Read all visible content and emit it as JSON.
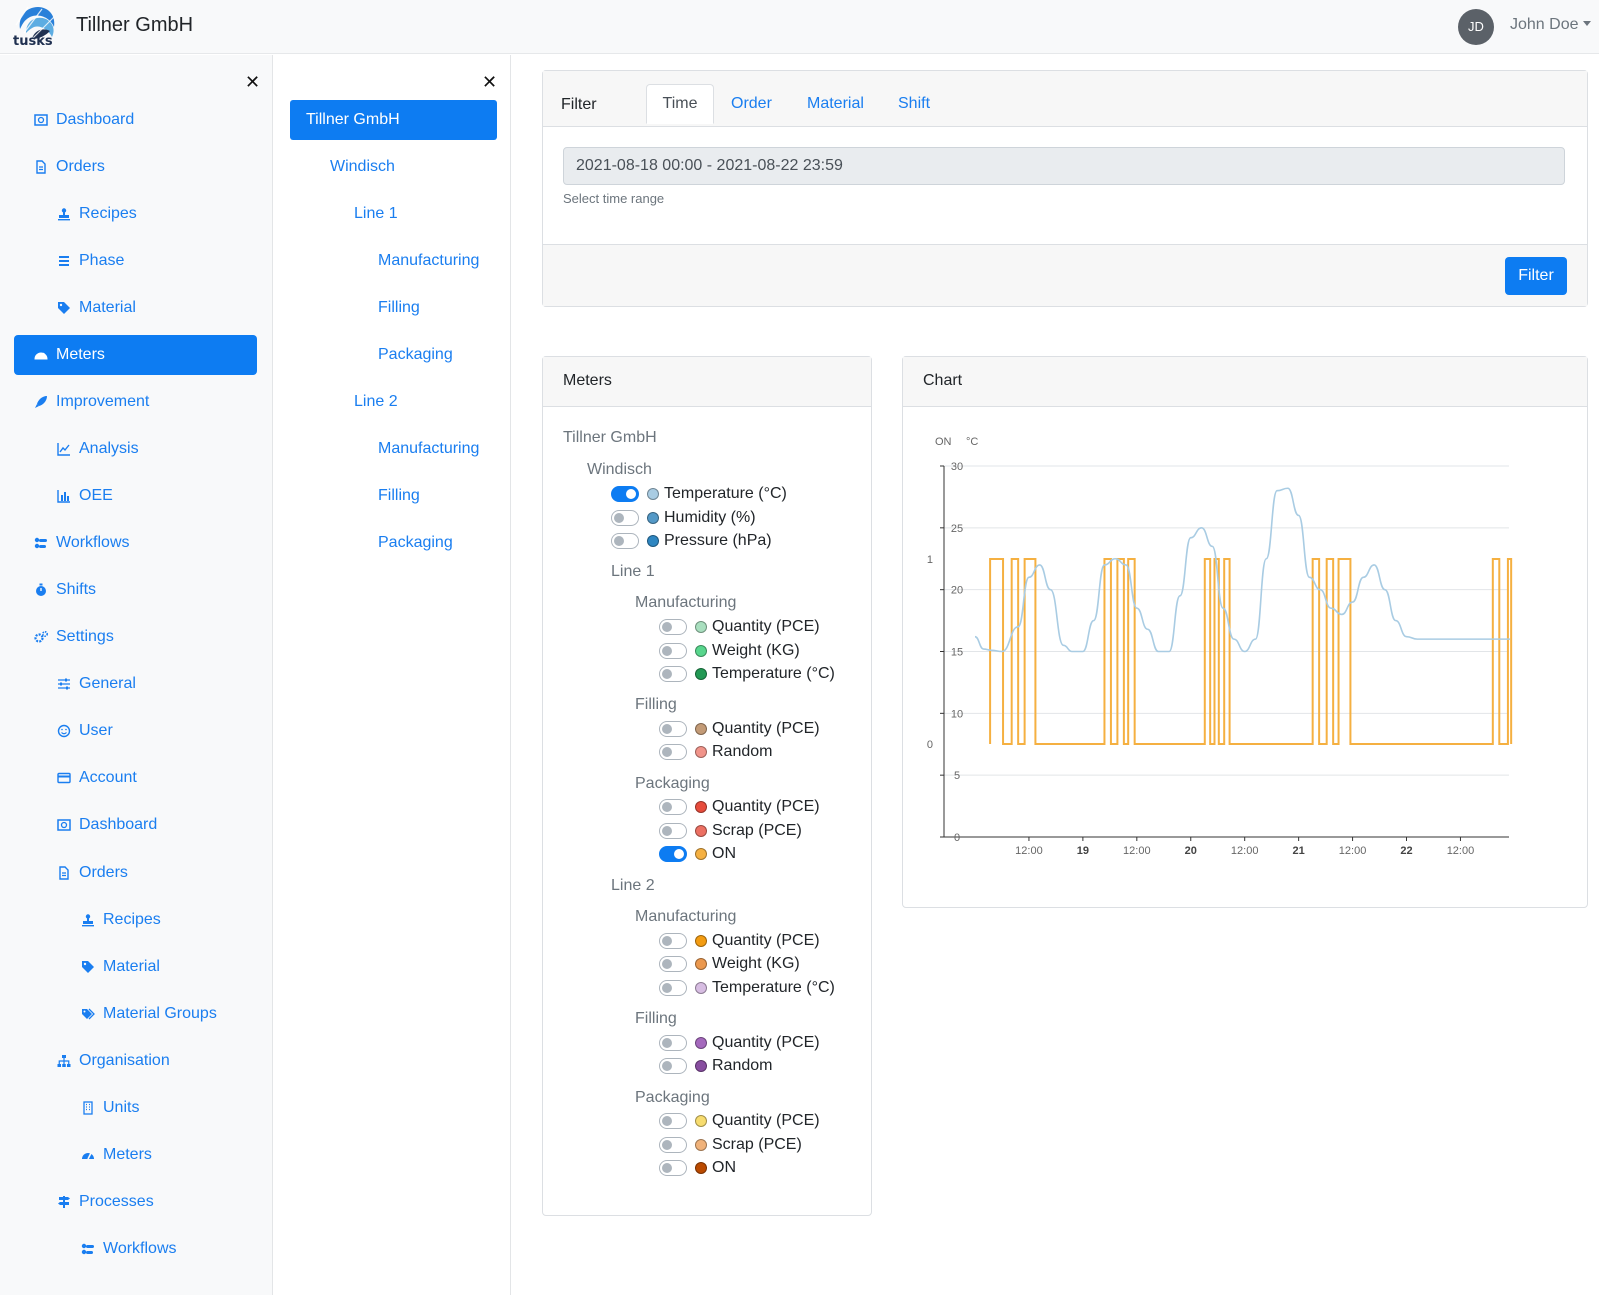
{
  "header": {
    "brand": "Tillner GmbH",
    "logo_text": "tusks",
    "avatar_initials": "JD",
    "user_name": "John Doe"
  },
  "sidebar": {
    "items": [
      {
        "label": "Dashboard",
        "icon": "dashboard-icon"
      },
      {
        "label": "Orders",
        "icon": "file-icon"
      },
      {
        "label": "Recipes",
        "icon": "stamp-icon"
      },
      {
        "label": "Phase",
        "icon": "stack-icon"
      },
      {
        "label": "Material",
        "icon": "tag-icon"
      },
      {
        "label": "Meters",
        "icon": "gauge-icon"
      },
      {
        "label": "Improvement",
        "icon": "rocket-icon"
      },
      {
        "label": "Analysis",
        "icon": "line-chart-icon"
      },
      {
        "label": "OEE",
        "icon": "bar-chart-icon"
      },
      {
        "label": "Workflows",
        "icon": "workflow-icon"
      },
      {
        "label": "Shifts",
        "icon": "stopwatch-icon"
      },
      {
        "label": "Settings",
        "icon": "gears-icon"
      },
      {
        "label": "General",
        "icon": "sliders-icon"
      },
      {
        "label": "User",
        "icon": "smile-icon"
      },
      {
        "label": "Account",
        "icon": "card-icon"
      },
      {
        "label": "Dashboard",
        "icon": "dashboard-icon"
      },
      {
        "label": "Orders",
        "icon": "file-icon"
      },
      {
        "label": "Recipes",
        "icon": "stamp-icon"
      },
      {
        "label": "Material",
        "icon": "tag-icon"
      },
      {
        "label": "Material Groups",
        "icon": "tags-icon"
      },
      {
        "label": "Organisation",
        "icon": "sitemap-icon"
      },
      {
        "label": "Units",
        "icon": "building-icon"
      },
      {
        "label": "Meters",
        "icon": "gauge-icon"
      },
      {
        "label": "Processes",
        "icon": "signpost-icon"
      },
      {
        "label": "Workflows",
        "icon": "workflow-icon"
      }
    ]
  },
  "tree": {
    "items": [
      {
        "label": "Tillner GmbH"
      },
      {
        "label": "Windisch"
      },
      {
        "label": "Line 1"
      },
      {
        "label": "Manufacturing"
      },
      {
        "label": "Filling"
      },
      {
        "label": "Packaging"
      },
      {
        "label": "Line 2"
      },
      {
        "label": "Manufacturing"
      },
      {
        "label": "Filling"
      },
      {
        "label": "Packaging"
      }
    ]
  },
  "filter": {
    "title": "Filter",
    "tabs": [
      "Time",
      "Order",
      "Material",
      "Shift"
    ],
    "range_value": "2021-08-18 00:00 - 2021-08-22 23:59",
    "help": "Select time range",
    "button": "Filter"
  },
  "meters": {
    "title": "Meters",
    "company": "Tillner GmbH",
    "site": "Windisch",
    "site_meters": [
      {
        "label": "Temperature (°C)",
        "color": "#a9cce3",
        "on": true
      },
      {
        "label": "Humidity (%)",
        "color": "#5499c7",
        "on": false
      },
      {
        "label": "Pressure (hPa)",
        "color": "#2e86c1",
        "on": false
      }
    ],
    "lines": [
      {
        "name": "Line 1",
        "groups": [
          {
            "name": "Manufacturing",
            "meters": [
              {
                "label": "Quantity (PCE)",
                "color": "#a9dfbf",
                "on": false
              },
              {
                "label": "Weight (KG)",
                "color": "#58d68d",
                "on": false
              },
              {
                "label": "Temperature (°C)",
                "color": "#229954",
                "on": false
              }
            ]
          },
          {
            "name": "Filling",
            "meters": [
              {
                "label": "Quantity (PCE)",
                "color": "#c39b77",
                "on": false
              },
              {
                "label": "Random",
                "color": "#f1948a",
                "on": false
              }
            ]
          },
          {
            "name": "Packaging",
            "meters": [
              {
                "label": "Quantity (PCE)",
                "color": "#e74c3c",
                "on": false
              },
              {
                "label": "Scrap (PCE)",
                "color": "#ec7063",
                "on": false
              },
              {
                "label": "ON",
                "color": "#f5b041",
                "on": true
              }
            ]
          }
        ]
      },
      {
        "name": "Line 2",
        "groups": [
          {
            "name": "Manufacturing",
            "meters": [
              {
                "label": "Quantity (PCE)",
                "color": "#f39c12",
                "on": false
              },
              {
                "label": "Weight (KG)",
                "color": "#eb984e",
                "on": false
              },
              {
                "label": "Temperature (°C)",
                "color": "#d7bde2",
                "on": false
              }
            ]
          },
          {
            "name": "Filling",
            "meters": [
              {
                "label": "Quantity (PCE)",
                "color": "#a569bd",
                "on": false
              },
              {
                "label": "Random",
                "color": "#884ea0",
                "on": false
              }
            ]
          },
          {
            "name": "Packaging",
            "meters": [
              {
                "label": "Quantity (PCE)",
                "color": "#f7dc6f",
                "on": false
              },
              {
                "label": "Scrap (PCE)",
                "color": "#f0b27a",
                "on": false
              },
              {
                "label": "ON",
                "color": "#ba4a00",
                "on": false
              }
            ]
          }
        ]
      }
    ]
  },
  "chart_card": {
    "title": "Chart"
  },
  "chart_data": {
    "type": "line",
    "left_axis_title": "ON",
    "right_axis_title": "°C",
    "y_on_ticks": [
      "0",
      "1"
    ],
    "y_temp_ticks": [
      "0",
      "5",
      "10",
      "15",
      "20",
      "25",
      "30"
    ],
    "y_temp_range": [
      0,
      30
    ],
    "x_range": [
      "2021-08-18 00:00",
      "2021-08-22 23:59"
    ],
    "x_ticks": [
      "12:00",
      "19",
      "12:00",
      "20",
      "12:00",
      "21",
      "12:00",
      "22",
      "12:00"
    ],
    "grid": true,
    "series": [
      {
        "name": "Temperature (°C)",
        "color": "#a9cce3",
        "axis": "right",
        "x": [
          0,
          0.08,
          0.15,
          0.25,
          0.4,
          0.5,
          0.6,
          0.7,
          0.82,
          0.9,
          1.0,
          1.1,
          1.2,
          1.3,
          1.4,
          1.5,
          1.6,
          1.7,
          1.8,
          1.9,
          2.0,
          2.1,
          2.2,
          2.3,
          2.4,
          2.5,
          2.6,
          2.7,
          2.8,
          2.9,
          3.0,
          3.1,
          3.2,
          3.3,
          3.4,
          3.5,
          3.6,
          3.7,
          3.8,
          3.9,
          4.0,
          4.1,
          4.2,
          4.3,
          4.4,
          4.5,
          4.6,
          4.7,
          4.8,
          4.9,
          4.96
        ],
        "y": [
          16.2,
          15.2,
          15.1,
          15.0,
          17.0,
          21.0,
          22.0,
          20.0,
          15.5,
          15.0,
          15.0,
          17.5,
          22.0,
          22.5,
          22.0,
          18.5,
          16.8,
          15.0,
          15.0,
          19.5,
          24.2,
          25.0,
          23.5,
          18.5,
          16.0,
          15.0,
          16.0,
          22.5,
          28.0,
          28.2,
          26.0,
          21.0,
          20.0,
          18.5,
          18.0,
          19.0,
          21.0,
          22.0,
          20.0,
          17.5,
          16.2,
          16.0,
          16.0,
          16.0,
          16.0,
          16.0,
          16.0,
          16.0,
          16.0,
          16.0,
          16.0
        ],
        "visible_until": 4.96
      },
      {
        "name": "ON",
        "color": "#f5b041",
        "axis": "left",
        "segments": [
          [
            0.14,
            0.26
          ],
          [
            0.34,
            0.4
          ],
          [
            0.46,
            0.56
          ],
          [
            1.2,
            1.26
          ],
          [
            1.32,
            1.38
          ],
          [
            1.42,
            1.48
          ],
          [
            2.13,
            2.18
          ],
          [
            2.22,
            2.26
          ],
          [
            2.31,
            2.36
          ],
          [
            3.13,
            3.19
          ],
          [
            3.26,
            3.32
          ],
          [
            3.37,
            3.48
          ],
          [
            4.8,
            4.86
          ],
          [
            4.94,
            4.97
          ]
        ]
      }
    ]
  }
}
